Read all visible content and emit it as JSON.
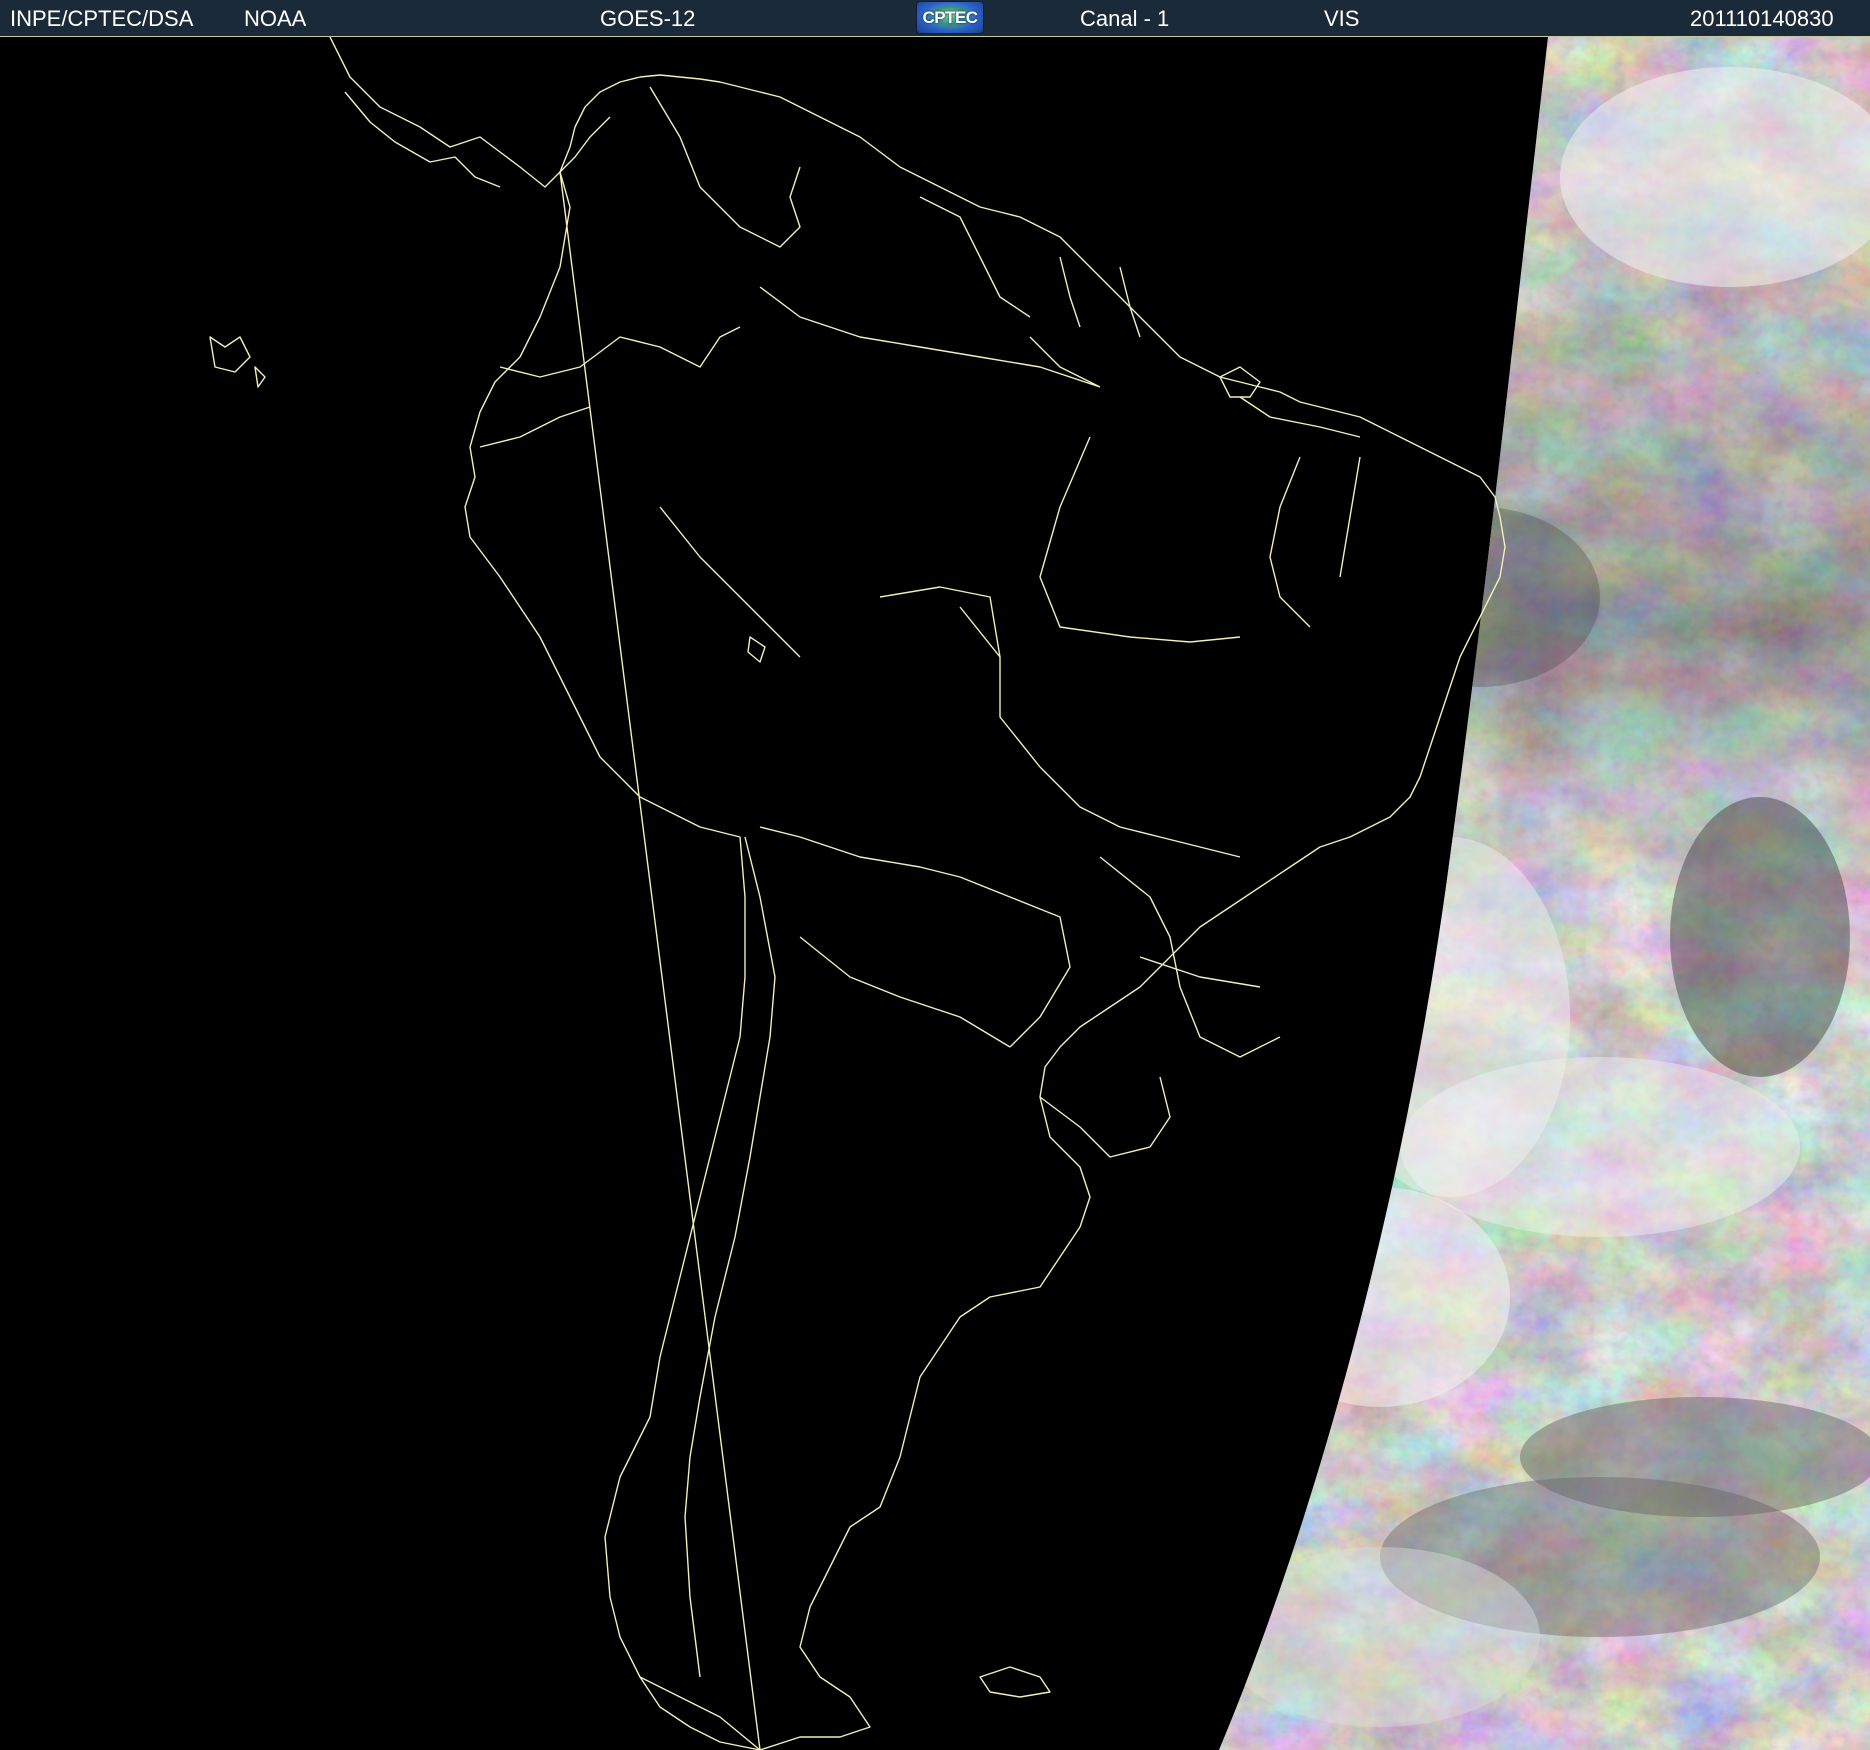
{
  "header": {
    "agency": "INPE/CPTEC/DSA",
    "operator": "NOAA",
    "satellite": "GOES-12",
    "logo_text": "CPTEC",
    "channel": "Canal - 1",
    "band": "VIS",
    "timestamp": "201110140830"
  },
  "colors": {
    "header_bg": "#1b2a38",
    "map_bg": "#000000",
    "border_lines": "#f0f0b8",
    "cloud_light": "#e8e8e8",
    "cloud_dark": "#5a5a5a"
  }
}
